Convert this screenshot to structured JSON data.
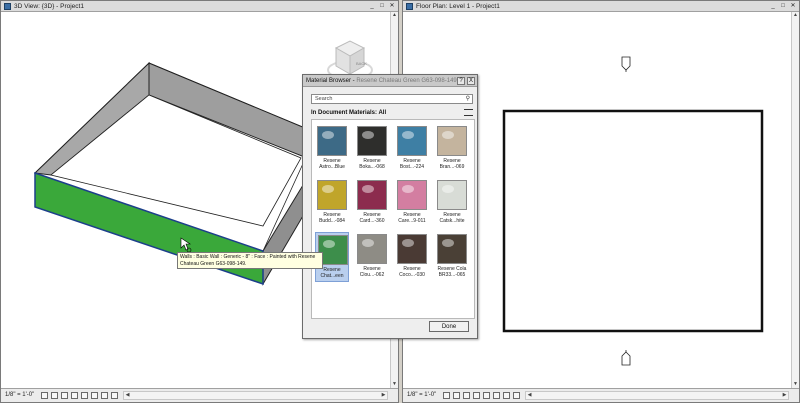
{
  "view3d": {
    "title": "3D View: {3D} - Project1",
    "scale": "1/8\" = 1'-0\"",
    "wall_face_color": "#3aa83a",
    "wall_color": "#a8a8a8",
    "viewcube_label": "BACK"
  },
  "viewplan": {
    "title": "Floor Plan: Level 1 - Project1",
    "scale": "1/8\" = 1'-0\""
  },
  "material_browser": {
    "title": "Material Browser - ",
    "title_material": "Resene Chateau Green G63-098-149",
    "help_label": "?",
    "close_label": "X",
    "search_placeholder": "Search",
    "section_label": "In Document Materials: All",
    "done_label": "Done",
    "materials": [
      {
        "line1": "Resene",
        "line2": "Astro...Blue",
        "color": "#3d6a86",
        "selected": false
      },
      {
        "line1": "Resene",
        "line2": "Boka...-068",
        "color": "#2e2e2c",
        "selected": false
      },
      {
        "line1": "Resene",
        "line2": "Bost...-224",
        "color": "#3e7fa4",
        "selected": false
      },
      {
        "line1": "Resene",
        "line2": "Bran...-069",
        "color": "#c4b49e",
        "selected": false
      },
      {
        "line1": "Resene",
        "line2": "Budd...-084",
        "color": "#c0a52a",
        "selected": false
      },
      {
        "line1": "Resene",
        "line2": "Card...-360",
        "color": "#8c2c4e",
        "selected": false
      },
      {
        "line1": "Resene",
        "line2": "Care...9-011",
        "color": "#d37ea1",
        "selected": false
      },
      {
        "line1": "Resene",
        "line2": "Catsk...hite",
        "color": "#d8dcd6",
        "selected": false
      },
      {
        "line1": "Resene",
        "line2": "Chat...een",
        "color": "#3d8e4b",
        "selected": true
      },
      {
        "line1": "Resene",
        "line2": "Clou...-062",
        "color": "#8e8c85",
        "selected": false
      },
      {
        "line1": "Resene",
        "line2": "Coco...-030",
        "color": "#4a3a34",
        "selected": false
      },
      {
        "line1": "Resene Cola",
        "line2": "BR33...-065",
        "color": "#4a4036",
        "selected": false
      }
    ]
  },
  "tooltip": {
    "line1": "Walls : Basic Wall : Generic - 8\" : Face : Painted with Resene",
    "line2": "Chateau Green G63-098-149."
  }
}
